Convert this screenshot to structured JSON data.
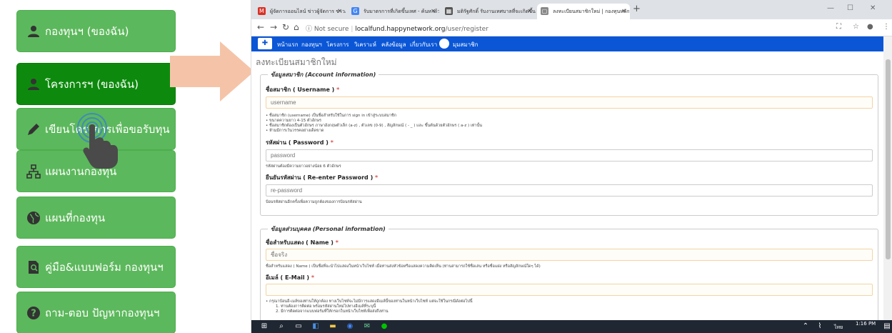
{
  "menu": {
    "items": [
      {
        "label": "กองทุนฯ (ของฉัน)",
        "icon": "user-icon"
      },
      {
        "label": "โครงการฯ (ของฉัน)",
        "icon": "user-icon"
      },
      {
        "label": "เขียนโครงการเพื่อขอรับทุน",
        "icon": "pencil-icon"
      },
      {
        "label": "แผนงานกองทุน",
        "icon": "sitemap-icon"
      },
      {
        "label": "แผนที่กองทุน",
        "icon": "globe-icon"
      },
      {
        "label": "คู่มือ&แบบฟอร์ม กองทุนฯ",
        "icon": "document-search-icon"
      },
      {
        "label": "ถาม-ตอบ ปัญหากองทุนฯ",
        "icon": "question-icon"
      }
    ],
    "active_index": 1
  },
  "browser": {
    "tabs": [
      {
        "title": "ผู้จัดการออนไลน์ ข่าวผู้จัดการ ข่าวภูมิภาค",
        "fav_color": "#d93025",
        "fav": "M"
      },
      {
        "title": "รับมาตรการที่เกิดขึ้นเทศ - ค้นหาด้วย Goo",
        "fav_color": "#4285f4",
        "fav": "G"
      },
      {
        "title": "มติรัฐศักดิ์ รับงานเทศบาลที่จะเกิดขึ้นในบริษัท",
        "fav_color": "#555555",
        "fav": "▦"
      },
      {
        "title": "ลงทะเบียนสมาชิกใหม่ | กองทุนหลักประ",
        "fav_color": "#888888",
        "fav": "▢"
      }
    ],
    "url_prefix": "Not secure",
    "url_host": "localfund.happynetwork.org",
    "url_path": "/user/register"
  },
  "sitenav": {
    "items": [
      "หน้าแรก",
      "กองทุนฯ",
      "โครงการ",
      "วิเคราะห์",
      "คลังข้อมูล",
      "เกี่ยวกับเรา",
      "มุมสมาชิก"
    ]
  },
  "form": {
    "page_title": "ลงทะเบียนสมาชิกใหม่",
    "account_legend": "ข้อมูลสมาชิก (Account information)",
    "username_label": "ชื่อสมาชิก ( Username )",
    "username_placeholder": "username",
    "username_help": [
      "• ชื่อสมาชิก (username) เป็นชื่อสำหรับใช้ในการ sign in เข้าสู่ระบบสมาชิก",
      "• ขนาดความยาว 4-15 ตัวอักษร",
      "• ชื่อสมาชิกต้องเป็นตัวอักษร ภาษาอังกฤษตัวเล็ก (a-z) , ตัวเลข (0-9) , สัญลักษณ์ ( - _ ) และ ขึ้นต้นด้วยตัวอักษร ( a-z ) เท่านั้น",
      "• ห้ามมีการเว้นวรรคอย่างเด็ดขาด"
    ],
    "password_label": "รหัสผ่าน ( Password )",
    "password_placeholder": "password",
    "password_help": "รหัสผ่านต้องมีความยาวอย่างน้อย 6 ตัวอักษร",
    "repassword_label": "ยืนยันรหัสผ่าน ( Re-enter Password )",
    "repassword_placeholder": "re-password",
    "repassword_help": "ป้อนรหัสผ่านอีกครั้งเพื่อความถูกต้องของการป้อนรหัสผ่าน",
    "personal_legend": "ข้อมูลส่วนบุคคล (Personal information)",
    "name_label": "ชื่อสำหรับแสดง ( Name )",
    "name_placeholder": "ชื่อจริง",
    "name_help": "ชื่อสำหรับแสดง ( Name ) เป็นชื่อที่จะนำไปแสดงในหน้าเว็บไซท์ เมื่อท่านส่งหัวข้อหรือแสดงความคิดเห็น (ท่านสามารถใช้ชื่อเล่น หรือชื่อแฝง หรือสัญลักษณ์ใดๆ ได้)",
    "email_label": "อีเมล์ ( E-Mail )",
    "email_help": [
      "• กรุณาป้อนอี-เมล์ของท่านให้ถูกต้อง ทางเว็บไซท์จะไม่มีการแสดงอีเมล์นี้ของท่านในหน้าเว็บไซท์ แต่จะใช้ในกรณีดังต่อไปนี้",
      "1. ท่านต้องการติดต่อ พร้อมรหัสผ่านใหม่ไปทางอีเมล์ที่ระบุนี้",
      "2. มีการติดต่อจากแบบฟอร์มที่ให้กรอกในหน้าเว็บไซท์เพื่อส่งถึงท่าน"
    ],
    "required_mark": "*"
  },
  "taskbar": {
    "time": "1:16 PM",
    "lang": "ไทย"
  },
  "colors": {
    "menu_green": "#5cb85c",
    "menu_active": "#0d8a0d",
    "sitenav_blue": "#0a56d6",
    "arrow": "#f5c4a8"
  }
}
